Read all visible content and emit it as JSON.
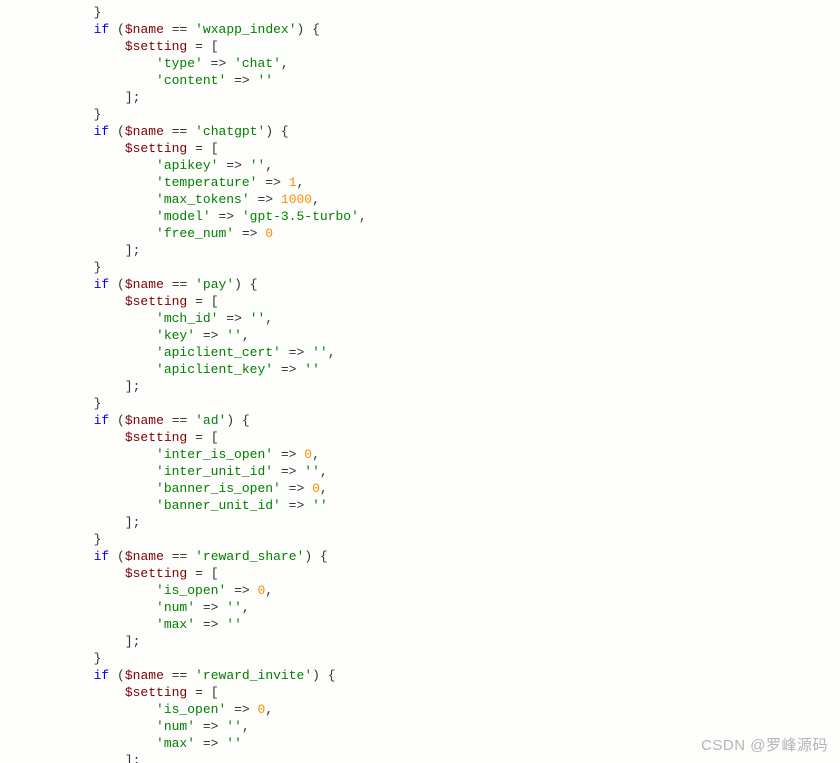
{
  "kw_if": "if",
  "var_name": "$name",
  "var_setting": "$setting",
  "op_eq": "==",
  "op_assign": "=",
  "op_arrow": "=>",
  "lbr": "[",
  "rbr_semi": "];",
  "lb": "{",
  "rb": "}",
  "rparen_lb": ") {",
  "lparen": "(",
  "comma": ",",
  "s_wxapp_index": "'wxapp_index'",
  "s_type": "'type'",
  "s_chat": "'chat'",
  "s_content": "'content'",
  "s_empty": "''",
  "s_chatgpt": "'chatgpt'",
  "s_apikey": "'apikey'",
  "s_temperature": "'temperature'",
  "n_1": "1",
  "s_max_tokens": "'max_tokens'",
  "n_1000": "1000",
  "s_model": "'model'",
  "s_gpt35": "'gpt-3.5-turbo'",
  "s_free_num": "'free_num'",
  "n_0": "0",
  "s_pay": "'pay'",
  "s_mch_id": "'mch_id'",
  "s_key": "'key'",
  "s_apiclient_cert": "'apiclient_cert'",
  "s_apiclient_key": "'apiclient_key'",
  "s_ad": "'ad'",
  "s_inter_is_open": "'inter_is_open'",
  "s_inter_unit_id": "'inter_unit_id'",
  "s_banner_is_open": "'banner_is_open'",
  "s_banner_unit_id": "'banner_unit_id'",
  "s_reward_share": "'reward_share'",
  "s_is_open": "'is_open'",
  "s_num": "'num'",
  "s_max": "'max'",
  "s_reward_invite": "'reward_invite'",
  "watermark": "CSDN @罗峰源码"
}
